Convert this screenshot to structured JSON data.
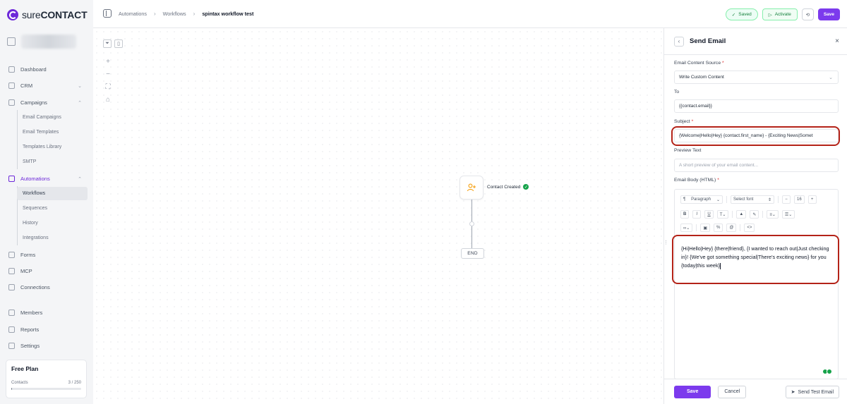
{
  "app": {
    "logo_text_light": "sure",
    "logo_text_bold": "CONTACT"
  },
  "sidebar": {
    "nav": [
      {
        "label": "Dashboard",
        "icon": "dashboard-icon"
      },
      {
        "label": "CRM",
        "icon": "crm-icon"
      },
      {
        "label": "Campaigns",
        "icon": "campaigns-icon"
      },
      {
        "label": "Automations",
        "icon": "automations-icon"
      },
      {
        "label": "Forms",
        "icon": "forms-icon"
      },
      {
        "label": "MCP",
        "icon": "mcp-icon"
      },
      {
        "label": "Connections",
        "icon": "connections-icon"
      },
      {
        "label": "Members",
        "icon": "members-icon"
      },
      {
        "label": "Reports",
        "icon": "reports-icon"
      },
      {
        "label": "Settings",
        "icon": "settings-icon"
      }
    ],
    "campaigns_sub": [
      "Email Campaigns",
      "Email Templates",
      "Templates Library",
      "SMTP"
    ],
    "automations_sub": [
      "Workflows",
      "Sequences",
      "History",
      "Integrations"
    ],
    "plan": {
      "title": "Free Plan",
      "contacts_label": "Contacts",
      "contacts_value": "3 / 250",
      "usage_fraction": 0.012
    }
  },
  "topbar": {
    "breadcrumb": [
      "Automations",
      "Workflows",
      "spintax workflow test"
    ],
    "saved_label": "Saved",
    "activate_label": "Activate",
    "save_label": "Save"
  },
  "canvas": {
    "trigger_label": "Contact Created",
    "end_label": "END"
  },
  "panel": {
    "title": "Send Email",
    "content_source_label": "Email Content Source",
    "content_source_value": "Write Custom Content",
    "to_label": "To",
    "to_value": "{{contact.email}}",
    "subject_label": "Subject",
    "subject_value": "{Welcome|Hello|Hey} {contact.first_name} - {Exciting News|Somet",
    "preview_label": "Preview Text",
    "preview_placeholder": "A short preview of your email content...",
    "body_label": "Email Body (HTML)",
    "toolbar": {
      "paragraph": "Paragraph",
      "font": "Select font",
      "size": "16",
      "minus": "−",
      "plus": "+"
    },
    "body_text": "{Hi|Hello|Hey} {there|friend}, {I wanted to reach out|Just checking in}! {We've got something special|There's exciting news} for you {today|this week}",
    "save_button": "Save",
    "cancel_button": "Cancel",
    "send_test_button": "Send Test Email"
  }
}
